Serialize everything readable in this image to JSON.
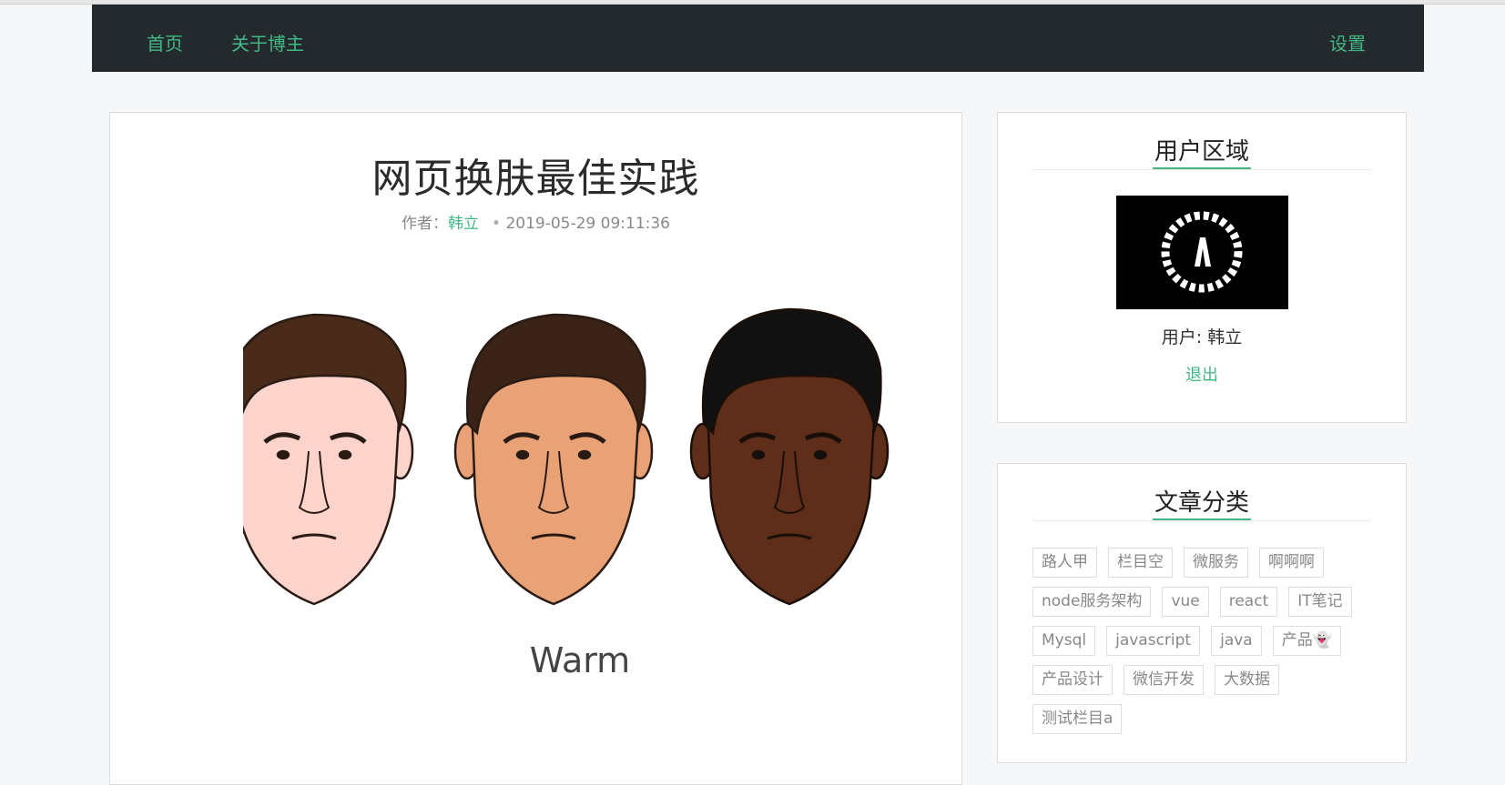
{
  "nav": {
    "home": "首页",
    "about": "关于博主",
    "settings": "设置"
  },
  "post": {
    "title": "网页换肤最佳实践",
    "author_prefix": "作者：",
    "author": "韩立",
    "date_sep": "•",
    "date": "2019-05-29 09:11:36",
    "image_caption": "Warm"
  },
  "user_area": {
    "title": "用户区域",
    "username": "用户: 韩立",
    "logout": "退出"
  },
  "categories": {
    "title": "文章分类",
    "tags": [
      "路人甲",
      "栏目空",
      "微服务",
      "啊啊啊",
      "node服务架构",
      "vue",
      "react",
      "IT笔记",
      "Mysql",
      "javascript",
      "java",
      "产品👻",
      "产品设计",
      "微信开发",
      "大数据",
      "测试栏目a"
    ]
  },
  "colors": {
    "accent": "#41b883",
    "navbar": "#24292d",
    "skin_light": "#fcd4cc",
    "skin_medium": "#e8a276",
    "skin_dark": "#5e2e1a"
  }
}
